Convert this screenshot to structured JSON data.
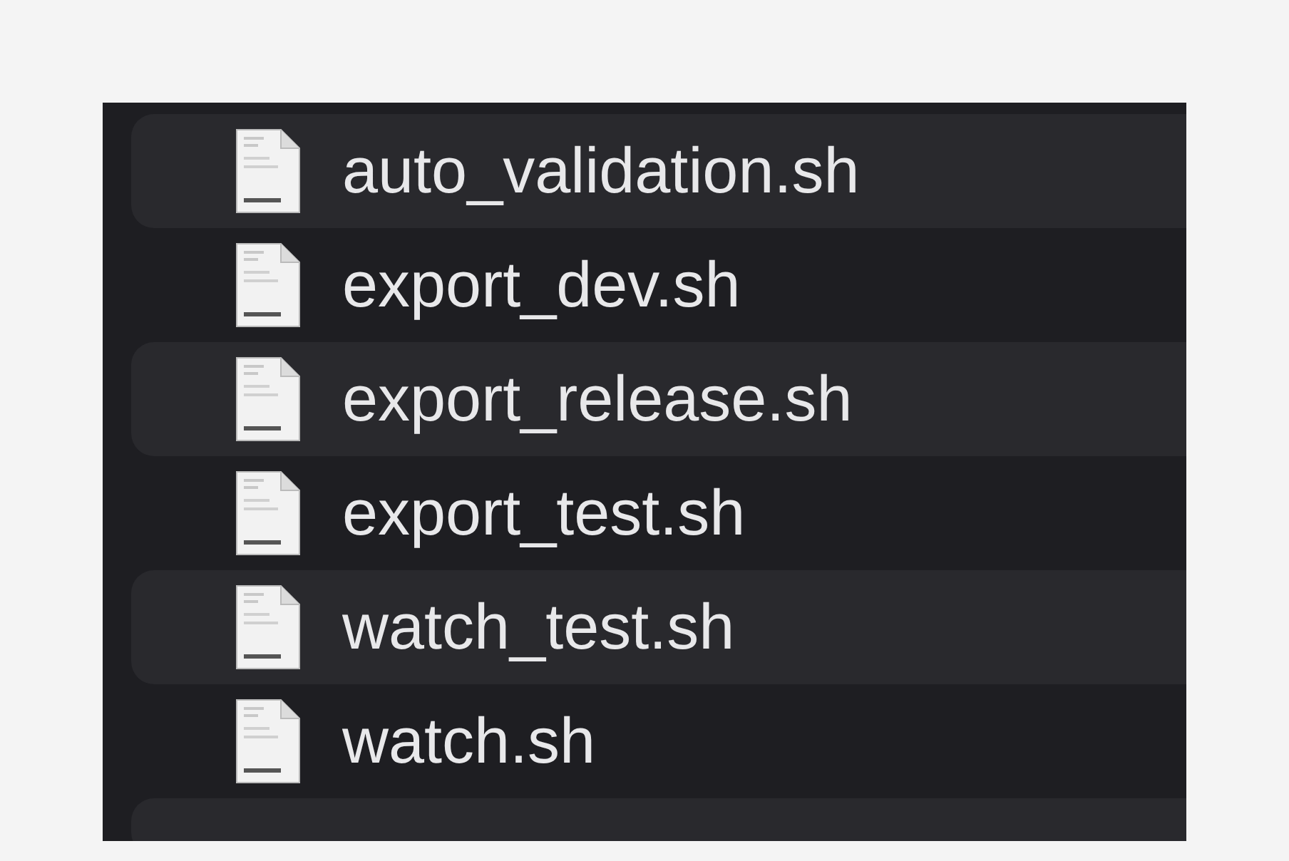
{
  "files": [
    {
      "name": "auto_validation.sh"
    },
    {
      "name": "export_dev.sh"
    },
    {
      "name": "export_release.sh"
    },
    {
      "name": "export_test.sh"
    },
    {
      "name": "watch_test.sh"
    },
    {
      "name": "watch.sh"
    }
  ]
}
